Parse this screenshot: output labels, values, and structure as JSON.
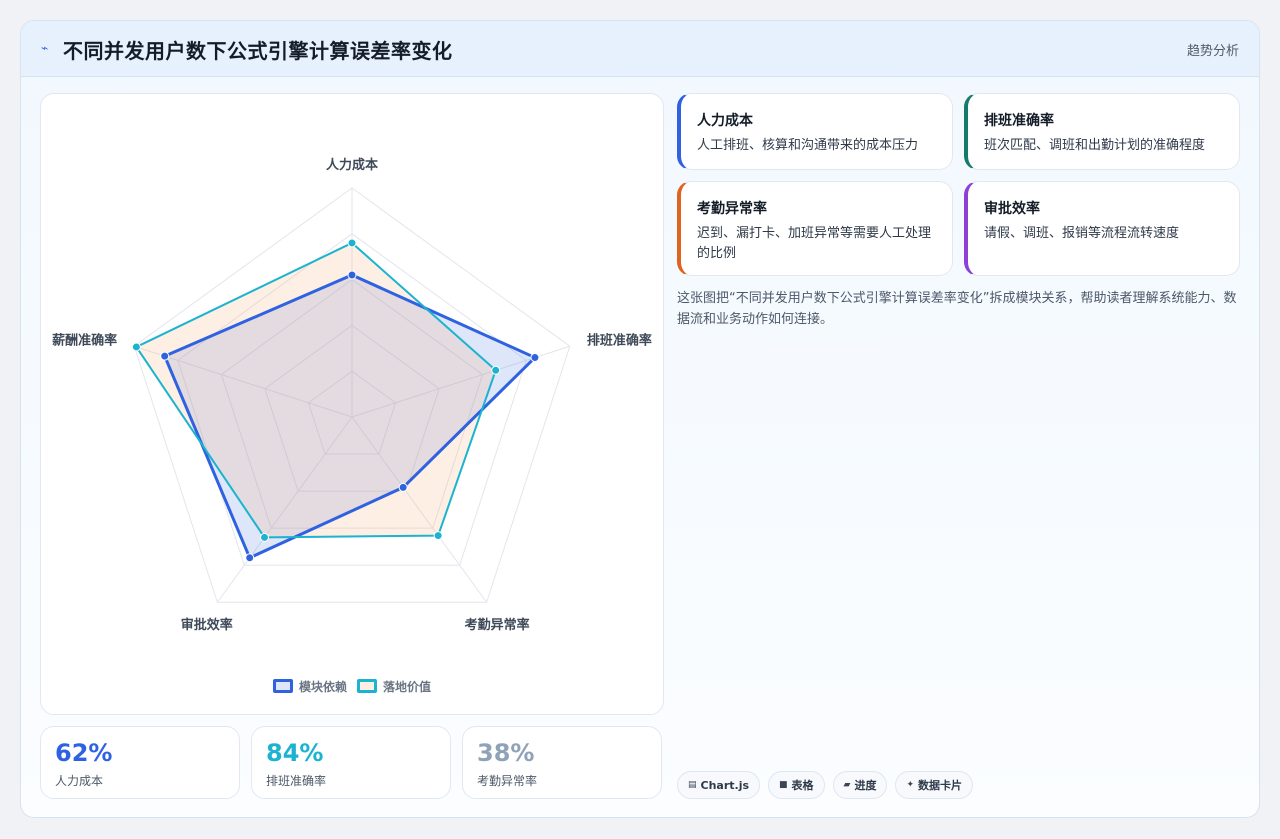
{
  "header": {
    "title": "不同并发用户数下公式引擎计算误差率变化",
    "tag": "趋势分析"
  },
  "chart_data": {
    "type": "radar",
    "axes": [
      "人力成本",
      "排班准确率",
      "考勤异常率",
      "审批效率",
      "薪酬准确率"
    ],
    "range": [
      0,
      100
    ],
    "grid_levels": 5,
    "legend_position": "bottom",
    "series": [
      {
        "name": "模块依赖",
        "values": [
          62,
          84,
          38,
          76,
          86
        ],
        "color": "#2f62e0",
        "fill": "rgba(47,98,224,0.16)"
      },
      {
        "name": "落地价值",
        "values": [
          76,
          66,
          64,
          65,
          99
        ],
        "color": "#1bb3cf",
        "fill": "rgba(248,180,130,0.22)"
      }
    ]
  },
  "stats": [
    {
      "value": "62%",
      "label": "人力成本",
      "color": "#2f62e0"
    },
    {
      "value": "84%",
      "label": "排班准确率",
      "color": "#1bb3cf"
    },
    {
      "value": "38%",
      "label": "考勤异常率",
      "color": "#8fa2b8"
    }
  ],
  "cards": [
    {
      "title": "人力成本",
      "desc": "人工排班、核算和沟通带来的成本压力",
      "accent": "#2f62e0"
    },
    {
      "title": "排班准确率",
      "desc": "班次匹配、调班和出勤计划的准确程度",
      "accent": "#147a6c"
    },
    {
      "title": "考勤异常率",
      "desc": "迟到、漏打卡、加班异常等需要人工处理的比例",
      "accent": "#e0641f"
    },
    {
      "title": "审批效率",
      "desc": "请假、调班、报销等流程流转速度",
      "accent": "#8d3fd8"
    }
  ],
  "description": "这张图把“不同并发用户数下公式引擎计算误差率变化”拆成模块关系，帮助读者理解系统能力、数据流和业务动作如何连接。",
  "chips": [
    {
      "icon": "chart-icon",
      "glyph": "▤",
      "label": "Chart.js"
    },
    {
      "icon": "table-icon",
      "glyph": "■",
      "label": "表格"
    },
    {
      "icon": "progress-icon",
      "glyph": "▰",
      "label": "进度"
    },
    {
      "icon": "data-card-icon",
      "glyph": "✦",
      "label": "数据卡片"
    }
  ]
}
